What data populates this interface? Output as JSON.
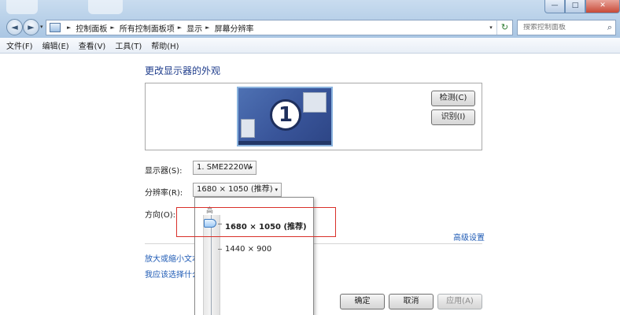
{
  "window": {
    "minimize_glyph": "—",
    "maximize_glyph": "□",
    "close_glyph": "✕"
  },
  "nav": {
    "back_glyph": "◄",
    "forward_glyph": "►",
    "history_glyph": "▾"
  },
  "address": {
    "crumbs": [
      "控制面板",
      "所有控制面板项",
      "显示",
      "屏幕分辨率"
    ],
    "separator": "►",
    "dropdown_glyph": "▾",
    "refresh_glyph": "↻"
  },
  "search": {
    "placeholder": "搜索控制面板",
    "icon_glyph": "⌕"
  },
  "menu": [
    "文件(F)",
    "编辑(E)",
    "查看(V)",
    "工具(T)",
    "帮助(H)"
  ],
  "content": {
    "heading": "更改显示器的外观",
    "monitor_number": "1",
    "detect_button": "检测(C)",
    "identify_button": "识别(I)",
    "display_label": "显示器(S):",
    "display_value": "1. SME2220W",
    "resolution_label": "分辨率(R):",
    "resolution_value": "1680 × 1050 (推荐)",
    "orientation_label": "方向(O):",
    "advanced_link": "高级设置",
    "text_size_link": "放大或缩小文本",
    "help_link": "我应该选择什么",
    "ok_button": "确定",
    "cancel_button": "取消",
    "apply_button": "应用(A)",
    "select_arrow": "▾"
  },
  "popup": {
    "high_label": "高",
    "options": [
      "1680 × 1050 (推荐)",
      "1440 × 900"
    ],
    "selected_index": 0
  }
}
